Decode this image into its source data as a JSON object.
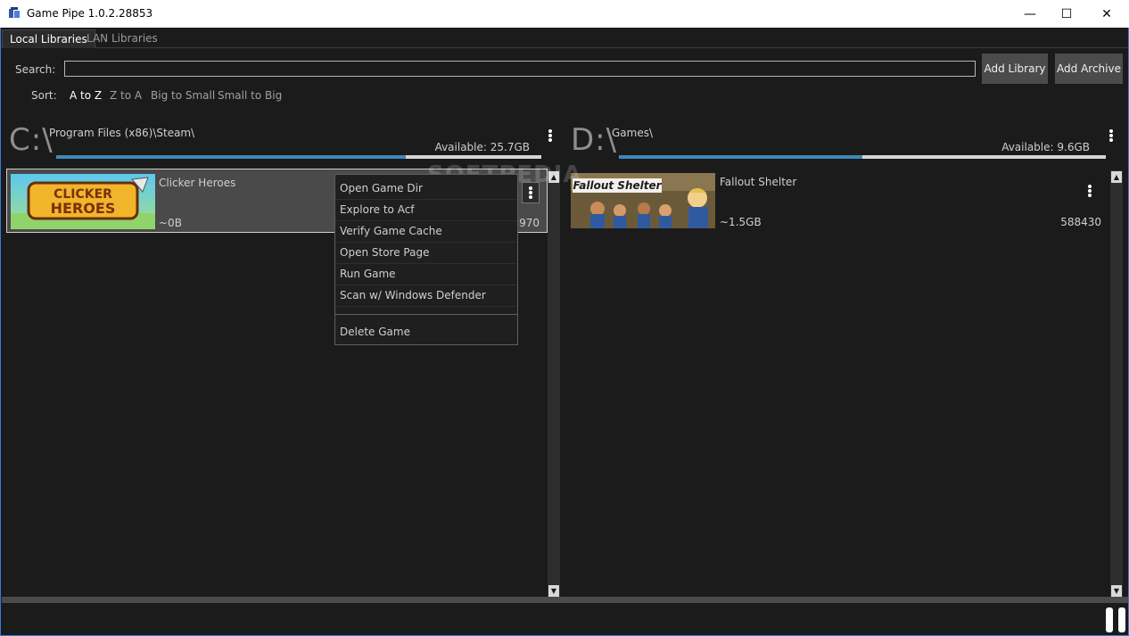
{
  "window": {
    "title": "Game Pipe 1.0.2.28853",
    "min_glyph": "—",
    "max_glyph": "☐",
    "close_glyph": "✕"
  },
  "tabs": [
    {
      "label": "Local Libraries",
      "active": true
    },
    {
      "label": "LAN Libraries",
      "active": false
    }
  ],
  "search": {
    "label": "Search:",
    "value": "",
    "placeholder": ""
  },
  "buttons": {
    "add_library": "Add Library",
    "add_archive": "Add Archive"
  },
  "sort": {
    "label": "Sort:",
    "options": [
      "A to Z",
      "Z to A",
      "Big to Small",
      "Small to Big"
    ],
    "selected": "A to Z"
  },
  "libraries": [
    {
      "drive": "C:\\",
      "path": "Program Files (x86)\\Steam\\",
      "available": "Available: 25.7GB",
      "used_fraction": 0.72,
      "games": [
        {
          "name": "Clicker Heroes",
          "size": "~0B",
          "id": "363970",
          "thumb_text": "CLICKER HEROES"
        }
      ]
    },
    {
      "drive": "D:\\",
      "path": "Games\\",
      "available": "Available: 9.6GB",
      "used_fraction": 0.5,
      "games": [
        {
          "name": "Fallout Shelter",
          "size": "~1.5GB",
          "id": "588430",
          "thumb_text": "Fallout Shelter"
        }
      ]
    }
  ],
  "context_menu": {
    "items": [
      "Open Game Dir",
      "Explore to Acf",
      "Verify Game Cache",
      "Open Store Page",
      "Run Game",
      "Scan w/ Windows Defender"
    ],
    "danger_item": "Delete Game"
  },
  "watermark": "SOFTPEDIA",
  "colors": {
    "accent": "#3f88b8",
    "background": "#1b1b1b",
    "button": "#4b4b4b"
  }
}
